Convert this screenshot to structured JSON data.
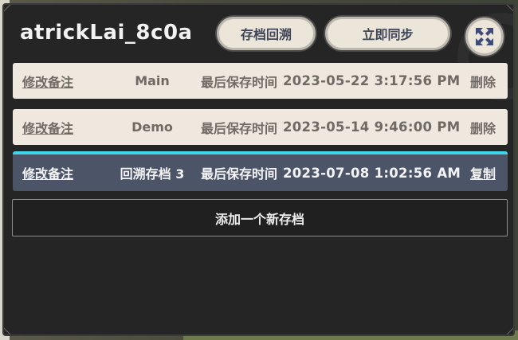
{
  "dialog": {
    "title": "atrickLai_8c0a",
    "rollback_label": "存档回溯",
    "sync_label": "立即同步",
    "close_icon": "expand-arrows-icon"
  },
  "saves": [
    {
      "edit_label": "修改备注",
      "name": "Main",
      "time_label": "最后保存时间",
      "time": "2023-05-22 3:17:56 PM",
      "action": "删除"
    },
    {
      "edit_label": "修改备注",
      "name": "Demo",
      "time_label": "最后保存时间",
      "time": "2023-05-14 9:46:00 PM",
      "action": "删除"
    },
    {
      "edit_label": "修改备注",
      "name": "回溯存档 3",
      "time_label": "最后保存时间",
      "time": "2023-07-08 1:02:56 AM",
      "action": "复制"
    }
  ],
  "add_label": "添加一个新存档",
  "colors": {
    "panel": "#252525",
    "row_light": "#efe8df",
    "row_active": "#4c5468",
    "accent": "#3fd6ea",
    "button": "#ece5da"
  }
}
